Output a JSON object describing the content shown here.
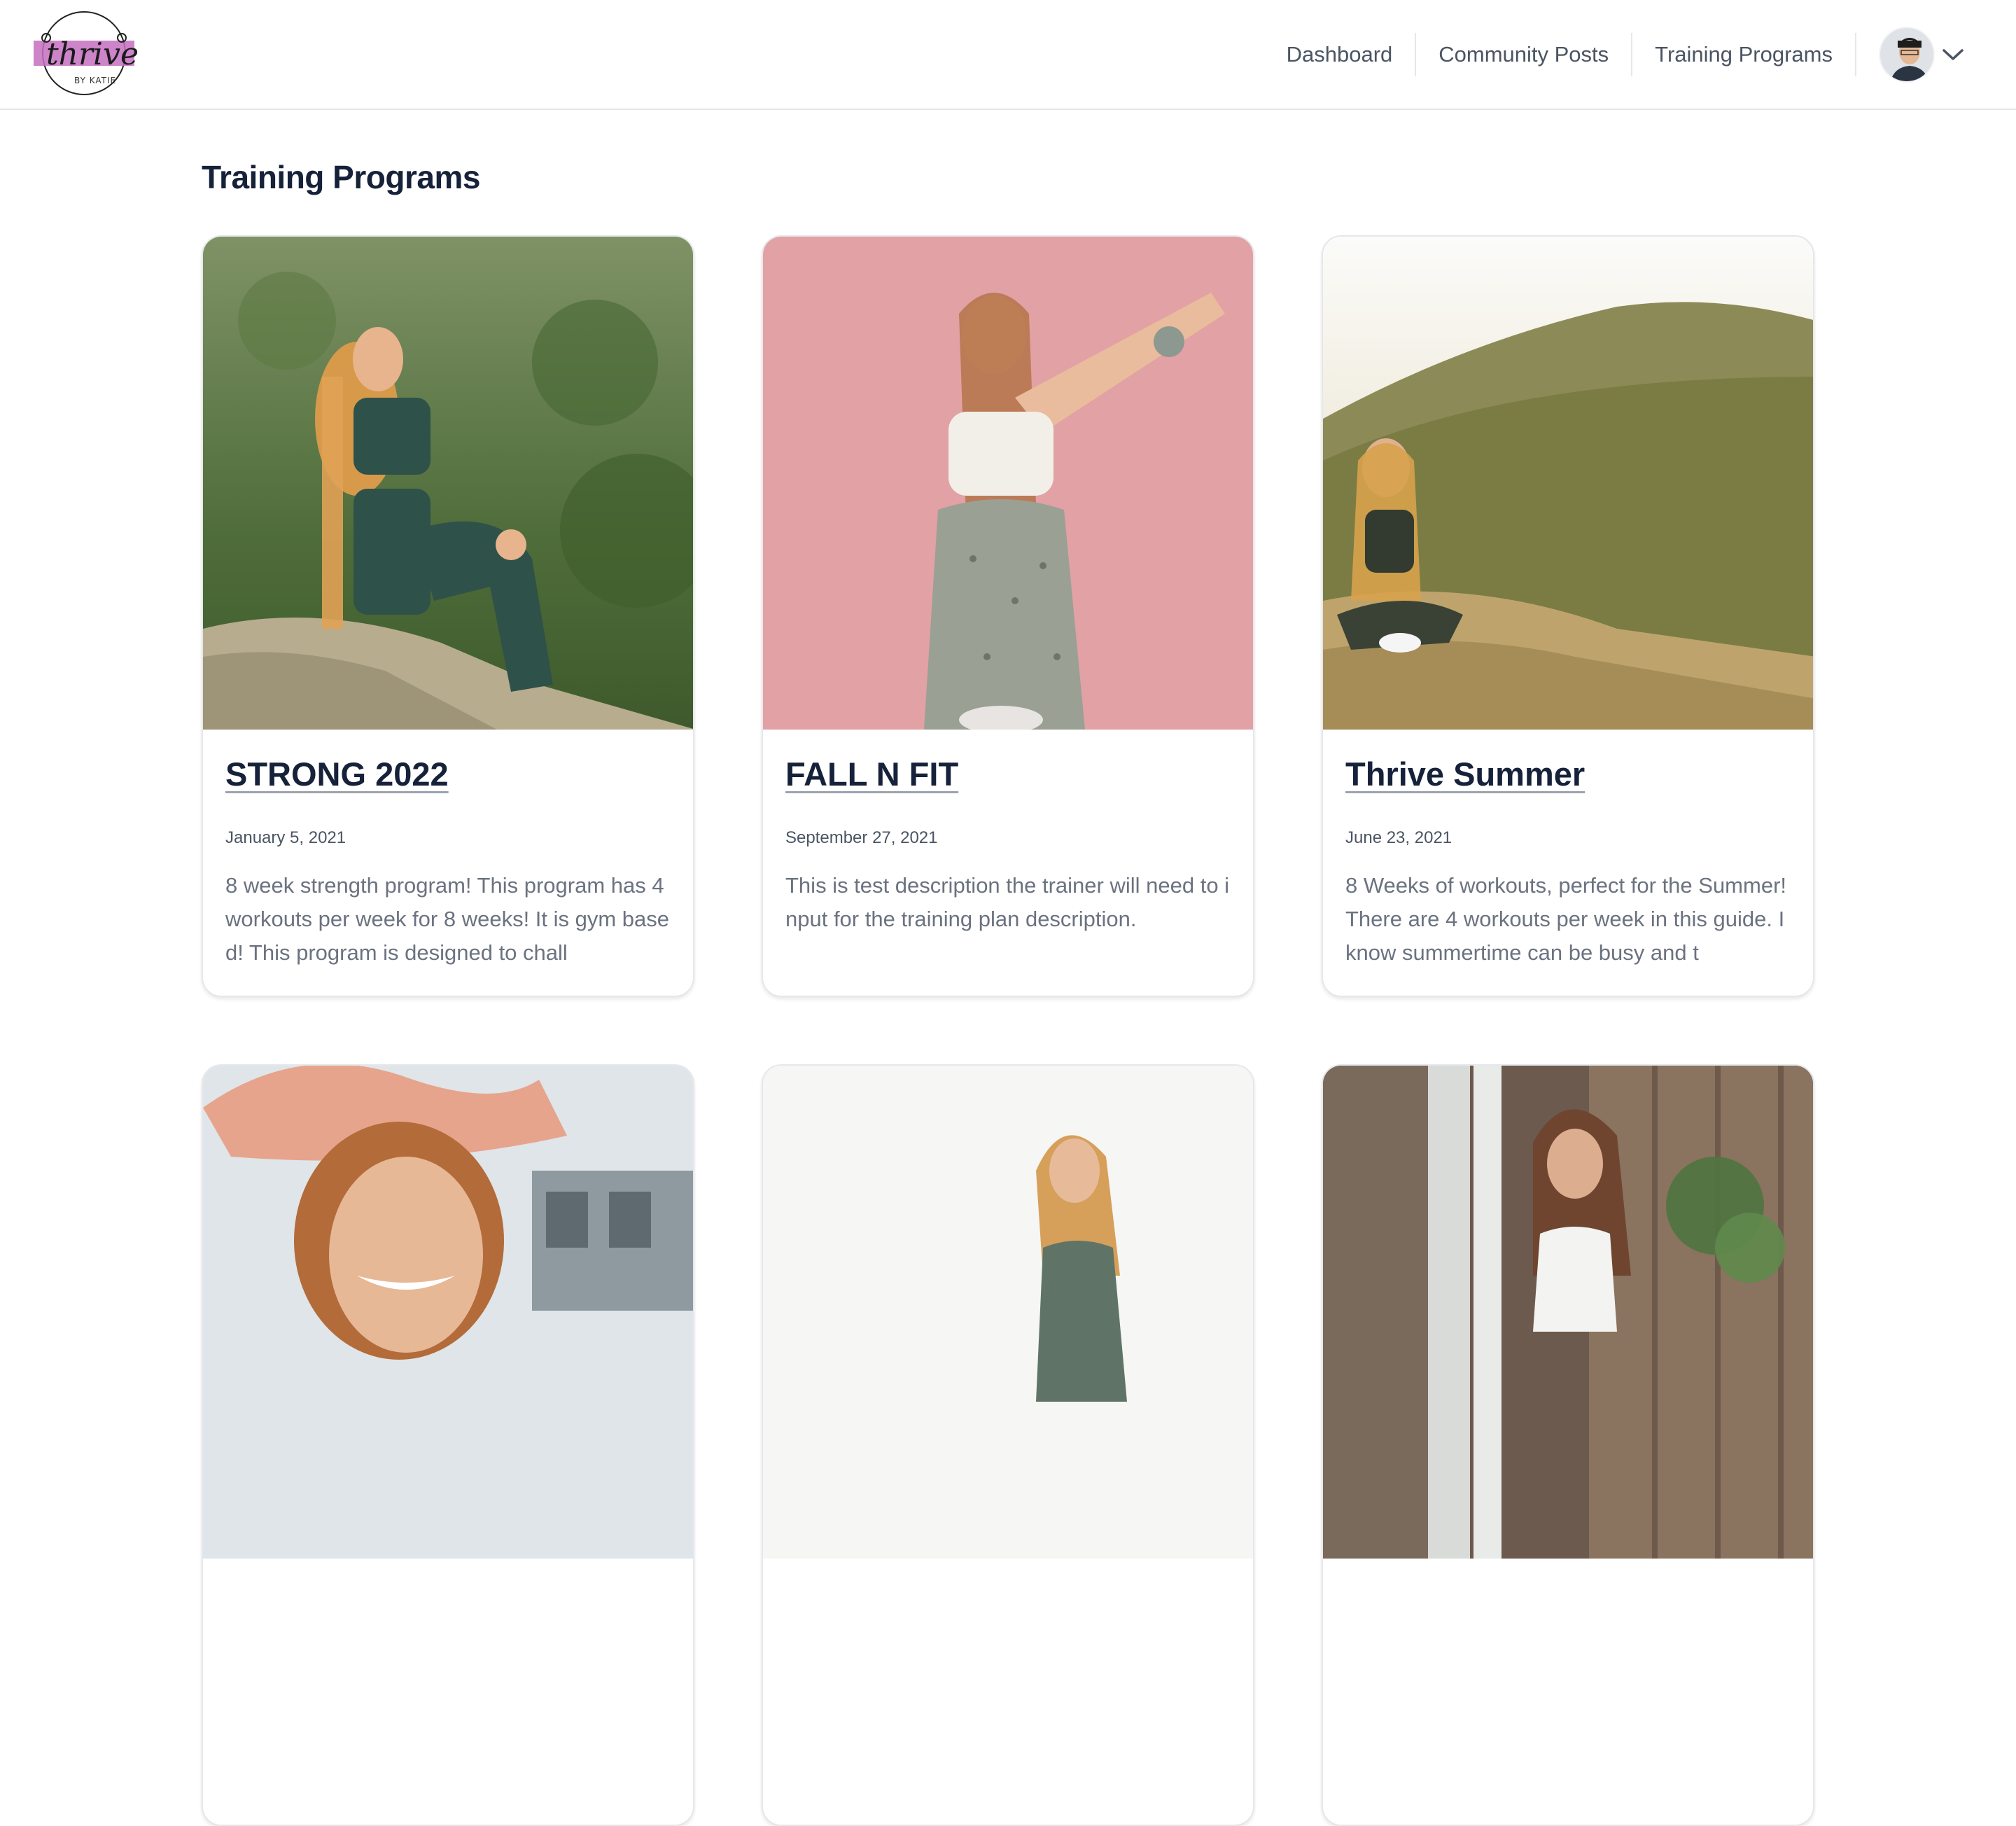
{
  "brand": {
    "logo_alt": "thrive by katie",
    "logo_text": "thrive",
    "logo_sub": "BY KATIE",
    "logo_color": "#c46fc0"
  },
  "nav": {
    "items": [
      {
        "label": "Dashboard"
      },
      {
        "label": "Community Posts"
      },
      {
        "label": "Training Programs"
      }
    ]
  },
  "user_menu": {
    "avatar_icon": "user-avatar",
    "dropdown_icon": "chevron-down-icon"
  },
  "page": {
    "title": "Training Programs"
  },
  "programs": [
    {
      "title": "STRONG 2022",
      "date": "January 5, 2021",
      "description": "8 week strength program! This program has 4 workouts per week for 8 weeks! It is gym based! This program is designed to chall",
      "image_theme": "green-hillside"
    },
    {
      "title": "FALL N FIT",
      "date": "September 27, 2021",
      "description": "This is test description the trainer will need to input for the training plan description.",
      "image_theme": "pink-studio"
    },
    {
      "title": "Thrive Summer",
      "date": "June 23, 2021",
      "description": "8 Weeks of workouts, perfect for the Summer! There are 4 workouts per week in this guide. I know summertime can be busy and t",
      "image_theme": "sunlit-hill"
    },
    {
      "title": "",
      "date": "",
      "description": "",
      "image_theme": "pink-hat"
    },
    {
      "title": "",
      "date": "",
      "description": "",
      "image_theme": "white-backdrop"
    },
    {
      "title": "",
      "date": "",
      "description": "",
      "image_theme": "fence-garden"
    }
  ]
}
